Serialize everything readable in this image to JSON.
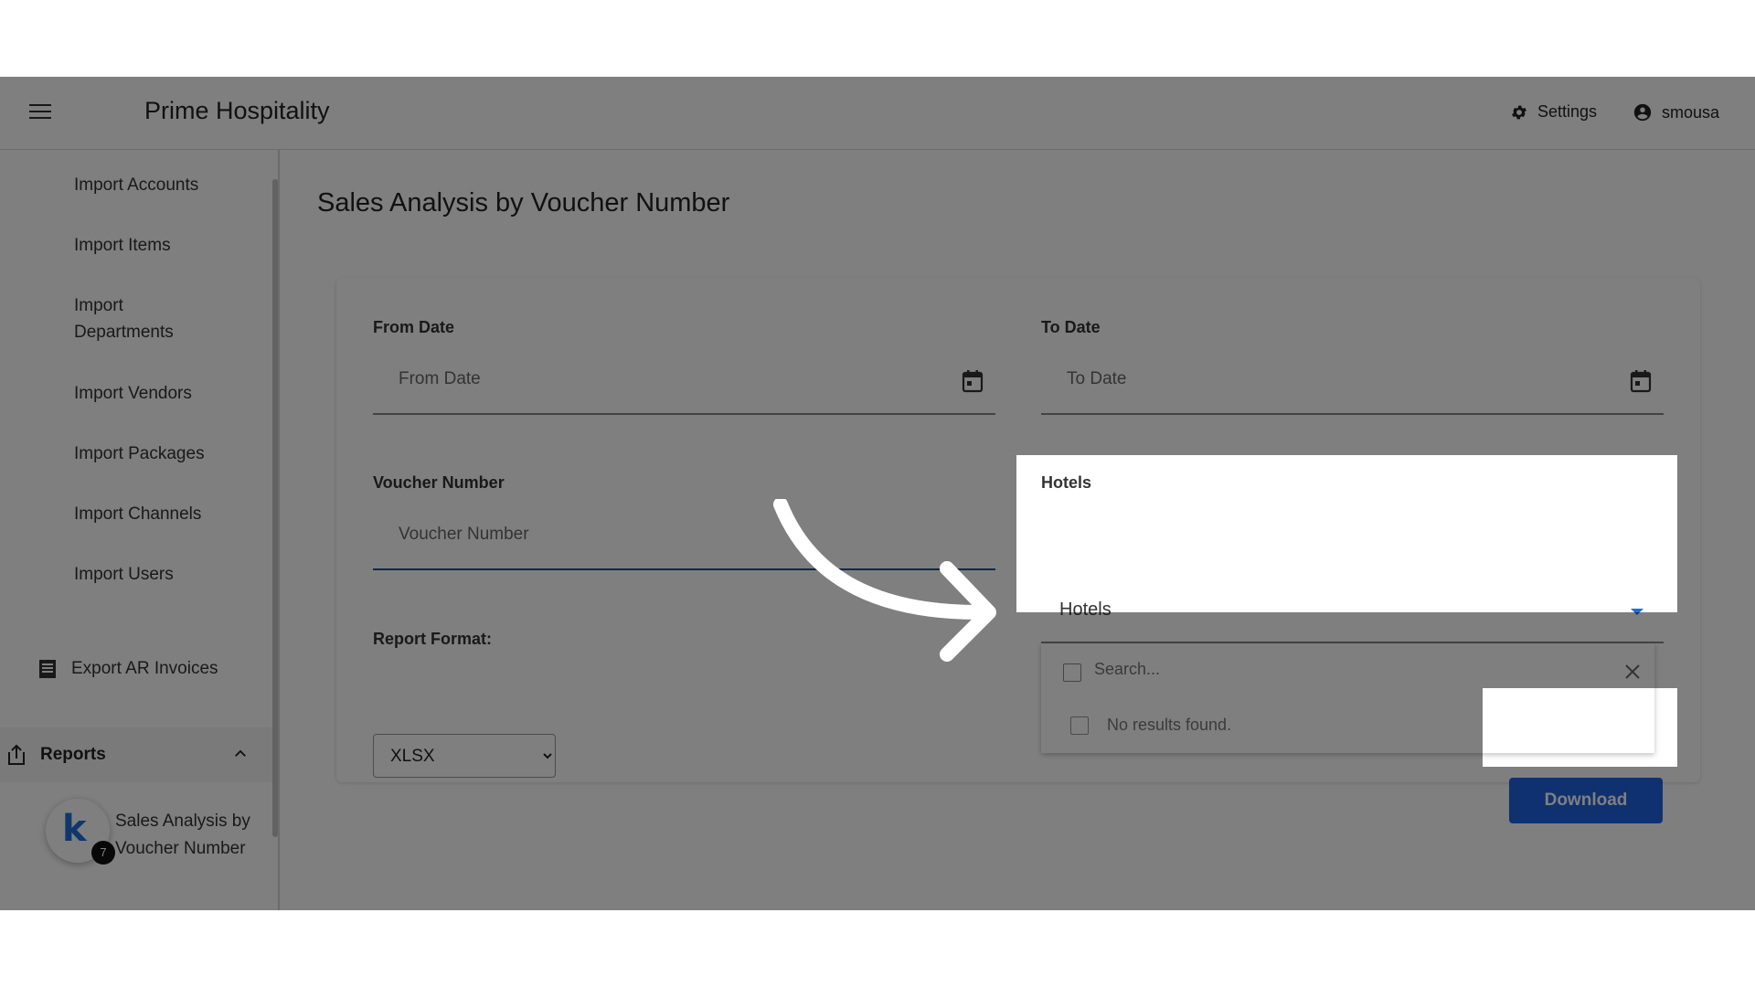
{
  "app": {
    "title": "Prime Hospitality"
  },
  "header": {
    "settings_label": "Settings",
    "user_label": "smousa"
  },
  "sidebar": {
    "items": [
      {
        "label": "Import Accounts"
      },
      {
        "label": "Import Items"
      },
      {
        "label": "Import Departments"
      },
      {
        "label": "Import Vendors"
      },
      {
        "label": "Import Packages"
      },
      {
        "label": "Import Channels"
      },
      {
        "label": "Import Users"
      }
    ],
    "export_label": "Export AR Invoices",
    "reports_label": "Reports",
    "sub_item_label": "Sales Analysis by Voucher Number",
    "badge_letter": "k",
    "badge_count": "7"
  },
  "main": {
    "page_title": "Sales Analysis by Voucher Number",
    "from_date": {
      "label": "From Date",
      "placeholder": "From Date"
    },
    "to_date": {
      "label": "To Date",
      "placeholder": "To Date"
    },
    "voucher": {
      "label": "Voucher Number",
      "placeholder": "Voucher Number"
    },
    "report_format": {
      "label": "Report Format:",
      "selected": "XLSX"
    },
    "hotels": {
      "label": "Hotels",
      "value": "Hotels",
      "search_placeholder": "Search...",
      "no_results": "No results found."
    },
    "download_label": "Download"
  },
  "colors": {
    "accent": "#1e63e0",
    "overlay": "rgba(0,0,0,0.5)"
  }
}
